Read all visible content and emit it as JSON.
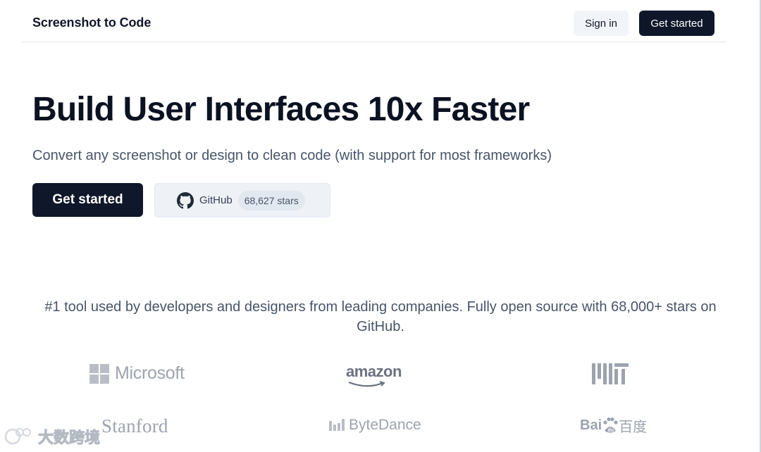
{
  "header": {
    "brand": "Screenshot to Code",
    "sign_in_label": "Sign in",
    "get_started_label": "Get started"
  },
  "hero": {
    "title": "Build User Interfaces 10x Faster",
    "subtitle": "Convert any screenshot or design to clean code (with support for most frameworks)",
    "cta_label": "Get started",
    "github_label": "GitHub",
    "github_stars": "68,627 stars"
  },
  "trust": {
    "text": "#1 tool used by developers and designers from leading companies. Fully open source with 68,000+ stars on GitHub."
  },
  "logos": {
    "microsoft": "Microsoft",
    "amazon": "amazon",
    "mit": "MIT",
    "stanford": "Stanford",
    "bytedance": "ByteDance",
    "baidu_latin": "Bai",
    "baidu_cn": "百度"
  },
  "watermark": {
    "text": "大数跨境"
  },
  "colors": {
    "primary": "#0f172a",
    "secondary_bg": "#f1f5f9",
    "muted_text": "#475569",
    "logo_gray": "#9ca3af"
  }
}
